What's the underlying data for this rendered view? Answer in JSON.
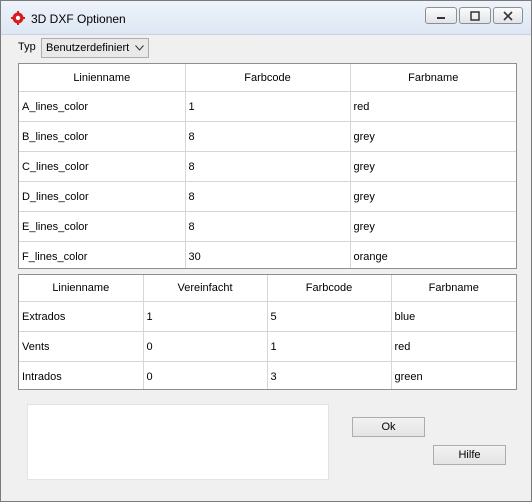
{
  "window": {
    "title": "3D DXF Optionen",
    "icon": "gear-icon",
    "controls": [
      "minimize-icon",
      "maximize-icon",
      "close-icon"
    ]
  },
  "typ": {
    "label": "Typ",
    "value": "Benutzerdefiniert"
  },
  "lines_table": {
    "columns": [
      "Linienname",
      "Farbcode",
      "Farbname"
    ],
    "rows": [
      [
        "A_lines_color",
        "1",
        "red"
      ],
      [
        "B_lines_color",
        "8",
        "grey"
      ],
      [
        "C_lines_color",
        "8",
        "grey"
      ],
      [
        "D_lines_color",
        "8",
        "grey"
      ],
      [
        "E_lines_color",
        "8",
        "grey"
      ],
      [
        "F_lines_color",
        "30",
        "orange"
      ]
    ]
  },
  "parts_table": {
    "columns": [
      "Linienname",
      "Vereinfacht",
      "Farbcode",
      "Farbname"
    ],
    "rows": [
      [
        "Extrados",
        "1",
        "5",
        "blue"
      ],
      [
        "Vents",
        "0",
        "1",
        "red"
      ],
      [
        "Intrados",
        "0",
        "3",
        "green"
      ]
    ]
  },
  "buttons": {
    "ok": "Ok",
    "help": "Hilfe"
  }
}
